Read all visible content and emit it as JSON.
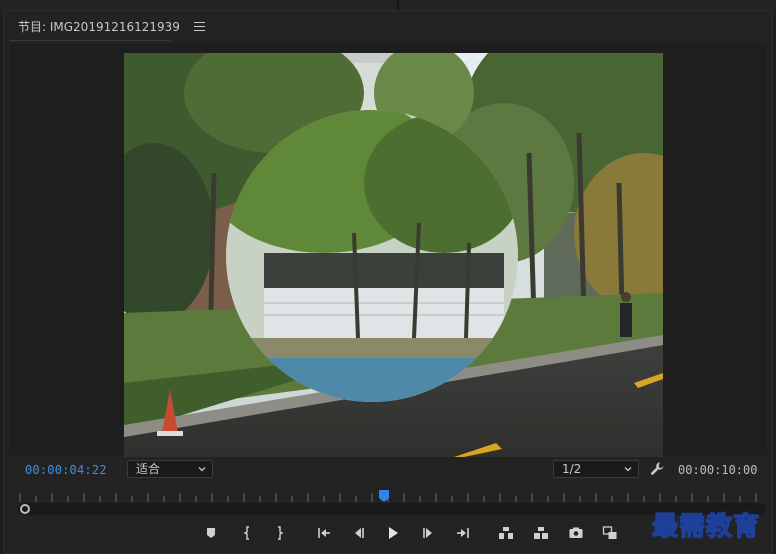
{
  "panel": {
    "title": "节目: IMG20191216121939",
    "menu_icon": "hamburger-menu-icon"
  },
  "timecode": {
    "current": "00:00:04:22",
    "duration": "00:00:10:00"
  },
  "controls": {
    "fit_select": "适合",
    "resolution_select": "1/2",
    "settings_icon": "wrench-icon"
  },
  "playback": {
    "playhead_fraction": 0.49
  },
  "transport_buttons": [
    "add-marker-icon",
    "mark-in-icon",
    "mark-out-icon",
    "go-to-in-icon",
    "step-back-icon",
    "play-icon",
    "step-forward-icon",
    "go-to-out-icon",
    "lift-icon",
    "extract-icon",
    "export-frame-icon",
    "comparison-view-icon"
  ],
  "watermark": "最需教育",
  "colors": {
    "timecode_accent": "#3f8fe0",
    "background": "#232323",
    "text": "#bdbdbd"
  }
}
